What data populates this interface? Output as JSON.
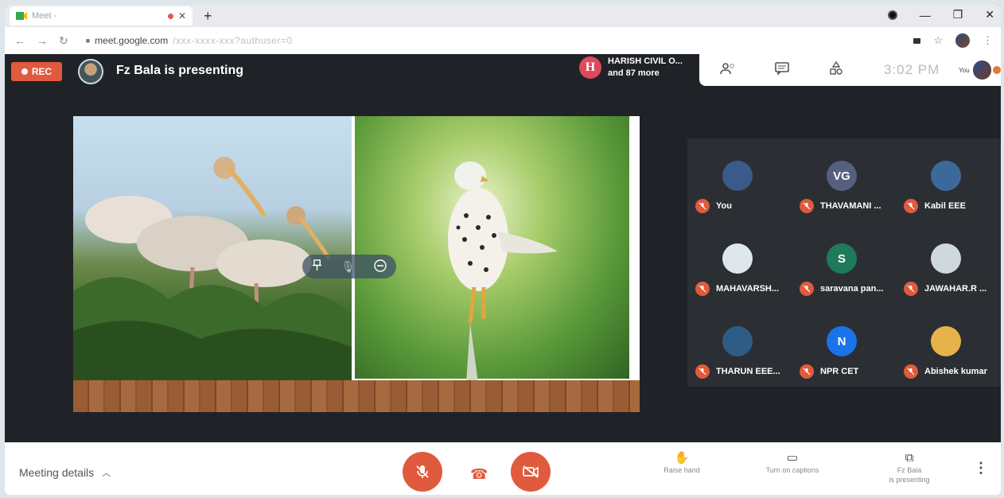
{
  "browser": {
    "tab_title": "Meet - ",
    "url_host": "meet.google.com",
    "url_path": "/xxx-xxxx-xxx?authuser=0"
  },
  "header": {
    "rec_label": "REC",
    "presenting_text": "Fz Bala is presenting",
    "participant_initial": "H",
    "participant_name": "HARISH CIVIL O...",
    "participant_more": "and 87 more",
    "time": "3:02 PM",
    "you_label": "You"
  },
  "participants": [
    {
      "name": "You",
      "initial": "",
      "color": "#3a5a8a"
    },
    {
      "name": "THAVAMANI ...",
      "initial": "VG",
      "color": "#556080"
    },
    {
      "name": "Kabil EEE",
      "initial": "",
      "color": "#3b6a9a"
    },
    {
      "name": "MAHAVARSH...",
      "initial": "",
      "color": "#dfe7ee"
    },
    {
      "name": "saravana pan...",
      "initial": "S",
      "color": "#1f7a5a"
    },
    {
      "name": "JAWAHAR.R ...",
      "initial": "",
      "color": "#cfd8dc"
    },
    {
      "name": "THARUN EEE...",
      "initial": "",
      "color": "#2d5c86"
    },
    {
      "name": "NPR CET",
      "initial": "N",
      "color": "#1a73e8"
    },
    {
      "name": "Abishek kumar",
      "initial": "",
      "color": "#e8b24a"
    }
  ],
  "bottom": {
    "meeting_details": "Meeting details",
    "raise_hand": "Raise hand",
    "captions": "Turn on captions",
    "presenter_line1": "Fz Bala",
    "presenter_line2": "is presenting"
  },
  "colors": {
    "accent_red": "#e05a3d",
    "meet_dark": "#1f2327"
  }
}
